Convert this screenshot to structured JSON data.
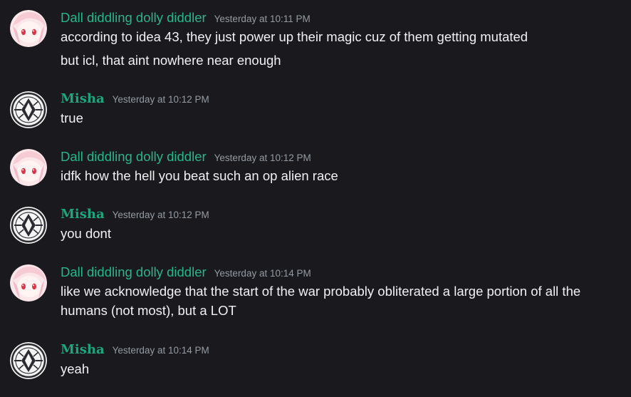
{
  "messages": [
    {
      "username": "Dall diddling dolly diddler",
      "timestamp": "Yesterday at 10:11 PM",
      "lines": [
        "according to idea 43, they just power up their magic cuz of them getting mutated",
        "but icl, that aint nowhere near enough"
      ]
    },
    {
      "username": "Misha",
      "timestamp": "Yesterday at 10:12 PM",
      "lines": [
        "true"
      ]
    },
    {
      "username": "Dall diddling dolly diddler",
      "timestamp": "Yesterday at 10:12 PM",
      "lines": [
        "idfk how the hell you beat such an op alien race"
      ]
    },
    {
      "username": "Misha",
      "timestamp": "Yesterday at 10:12 PM",
      "lines": [
        "you dont"
      ]
    },
    {
      "username": "Dall diddling dolly diddler",
      "timestamp": "Yesterday at 10:14 PM",
      "lines": [
        "like we acknowledge that the start of the war probably obliterated a large portion of all the",
        "humans (not most), but a LOT"
      ]
    },
    {
      "username": "Misha",
      "timestamp": "Yesterday at 10:14 PM",
      "lines": [
        "yeah"
      ]
    }
  ],
  "colors": {
    "background": "#1a1a1e",
    "username_teal": "#27b68b",
    "timestamp_gray": "#949ba4",
    "message_text": "#f0f1f3"
  },
  "icons": {
    "pink_avatar": "anime-girl-avatar-icon",
    "ornate_avatar": "ornate-emblem-avatar-icon"
  }
}
